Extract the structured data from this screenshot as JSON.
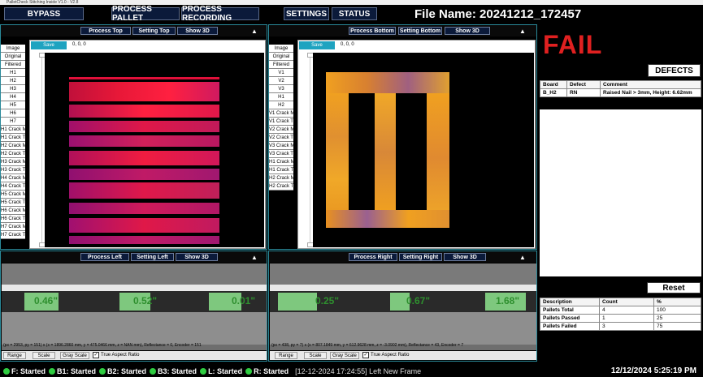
{
  "window": {
    "title": "PalletCheck Stitching Inside V1.0 - V2.8"
  },
  "toolbar": {
    "bypass": "BYPASS",
    "process_pallet": "PROCESS PALLET",
    "process_recording": "PROCESS RECORDING",
    "settings": "SETTINGS",
    "status": "STATUS",
    "file_name": "File Name: 20241212_172457"
  },
  "top_left": {
    "process": "Process Top",
    "setting": "Setting Top",
    "show3d": "Show 3D",
    "save": "Save",
    "coord": "0, 0, 0",
    "layers": [
      "Image",
      "Original",
      "Filtered",
      "H1",
      "H2",
      "H3",
      "H4",
      "H5",
      "H6",
      "H7",
      "H1 Crack M",
      "H1 Crack T",
      "H2 Crack M",
      "H2 Crack T",
      "H3 Crack M",
      "H3 Crack T",
      "H4 Crack M",
      "H4 Crack T",
      "H5 Crack M",
      "H5 Crack T",
      "H6 Crack M",
      "H6 Crack T",
      "H7 Crack M",
      "H7 Crack T"
    ]
  },
  "top_right": {
    "process": "Process Bottom",
    "setting": "Setting Bottom",
    "show3d": "Show 3D",
    "save": "Save",
    "coord": "0, 0, 0",
    "layers": [
      "Image",
      "Original",
      "Filtered",
      "V1",
      "V2",
      "V3",
      "H1",
      "H2",
      "V1 Crack M",
      "V1 Crack T",
      "V2 Crack M",
      "V2 Crack T",
      "V3 Crack M",
      "V3 Crack T",
      "H1 Crack M",
      "H1 Crack T",
      "H2 Crack M",
      "H2 Crack T"
    ]
  },
  "bottom_left": {
    "process": "Process Left",
    "setting": "Setting Left",
    "show3d": "Show 3D",
    "values": [
      "0.46\"",
      "0.52\"",
      "0.01\""
    ],
    "footer": "(px = 2953, py = 151) x (x = 1896.2860 mm, y = 475.0466 mm, z = NAN mm), Reflectance = 0, Encoder = 151",
    "range": "Range",
    "scale": "Scale",
    "gray": "Gray Scale",
    "aspect": "True Aspect Ratio"
  },
  "bottom_right": {
    "process": "Process Right",
    "setting": "Setting Right",
    "show3d": "Show 3D",
    "values": [
      "0.25\"",
      "0.67\"",
      "1.68\""
    ],
    "footer": "(px = 438, py = 7) x (x = 807.1849 mm, y = 612.9628 mm, z = -3.0902 mm), Reflectance = 43, Encoder = 7",
    "range": "Range",
    "scale": "Scale",
    "gray": "Gray Scale",
    "aspect": "True Aspect Ratio"
  },
  "result": {
    "status": "FAIL"
  },
  "defects": {
    "button": "DEFECTS",
    "headers": [
      "Board",
      "Defect",
      "Comment"
    ],
    "rows": [
      {
        "board": "B_H2",
        "defect": "RN",
        "comment": "Raised Nail > 3mm, Height: 6.62mm"
      }
    ]
  },
  "stats": {
    "reset": "Reset",
    "headers": [
      "Description",
      "Count",
      "%"
    ],
    "rows": [
      {
        "desc": "Pallets Total",
        "count": "4",
        "pct": "100"
      },
      {
        "desc": "Pallets Passed",
        "count": "1",
        "pct": "25"
      },
      {
        "desc": "Pallets Failed",
        "count": "3",
        "pct": "75"
      }
    ]
  },
  "statusbar": {
    "items": [
      "F: Started",
      "B1: Started",
      "B2: Started",
      "B3: Started",
      "L: Started",
      "R: Started"
    ],
    "message": "[12-12-2024 17:24:55] Left New Frame",
    "time": "12/12/2024 5:25:19 PM"
  },
  "colors": {
    "fail": "#e02020",
    "accent": "#1ea3c0",
    "ok": "#2ecc40"
  }
}
